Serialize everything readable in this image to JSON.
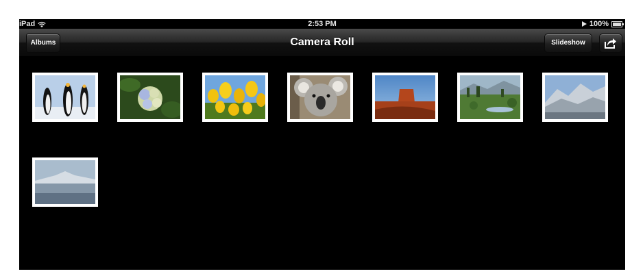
{
  "statusbar": {
    "device": "iPad",
    "time": "2:53 PM",
    "battery": "100%",
    "icons": [
      "wifi-icon",
      "play-icon",
      "battery-icon"
    ]
  },
  "navbar": {
    "title": "Camera Roll",
    "back_label": "Albums",
    "slideshow_label": "Slideshow",
    "share_icon": "share-icon"
  },
  "photos": [
    {
      "name": "penguins"
    },
    {
      "name": "hydrangeas"
    },
    {
      "name": "tulips"
    },
    {
      "name": "koala"
    },
    {
      "name": "desert"
    },
    {
      "name": "meadow"
    },
    {
      "name": "mountains"
    },
    {
      "name": "snowy-peak"
    }
  ],
  "colors": {
    "background": "#000000",
    "thumbnail_border": "#ffffff",
    "text": "#ffffff"
  }
}
